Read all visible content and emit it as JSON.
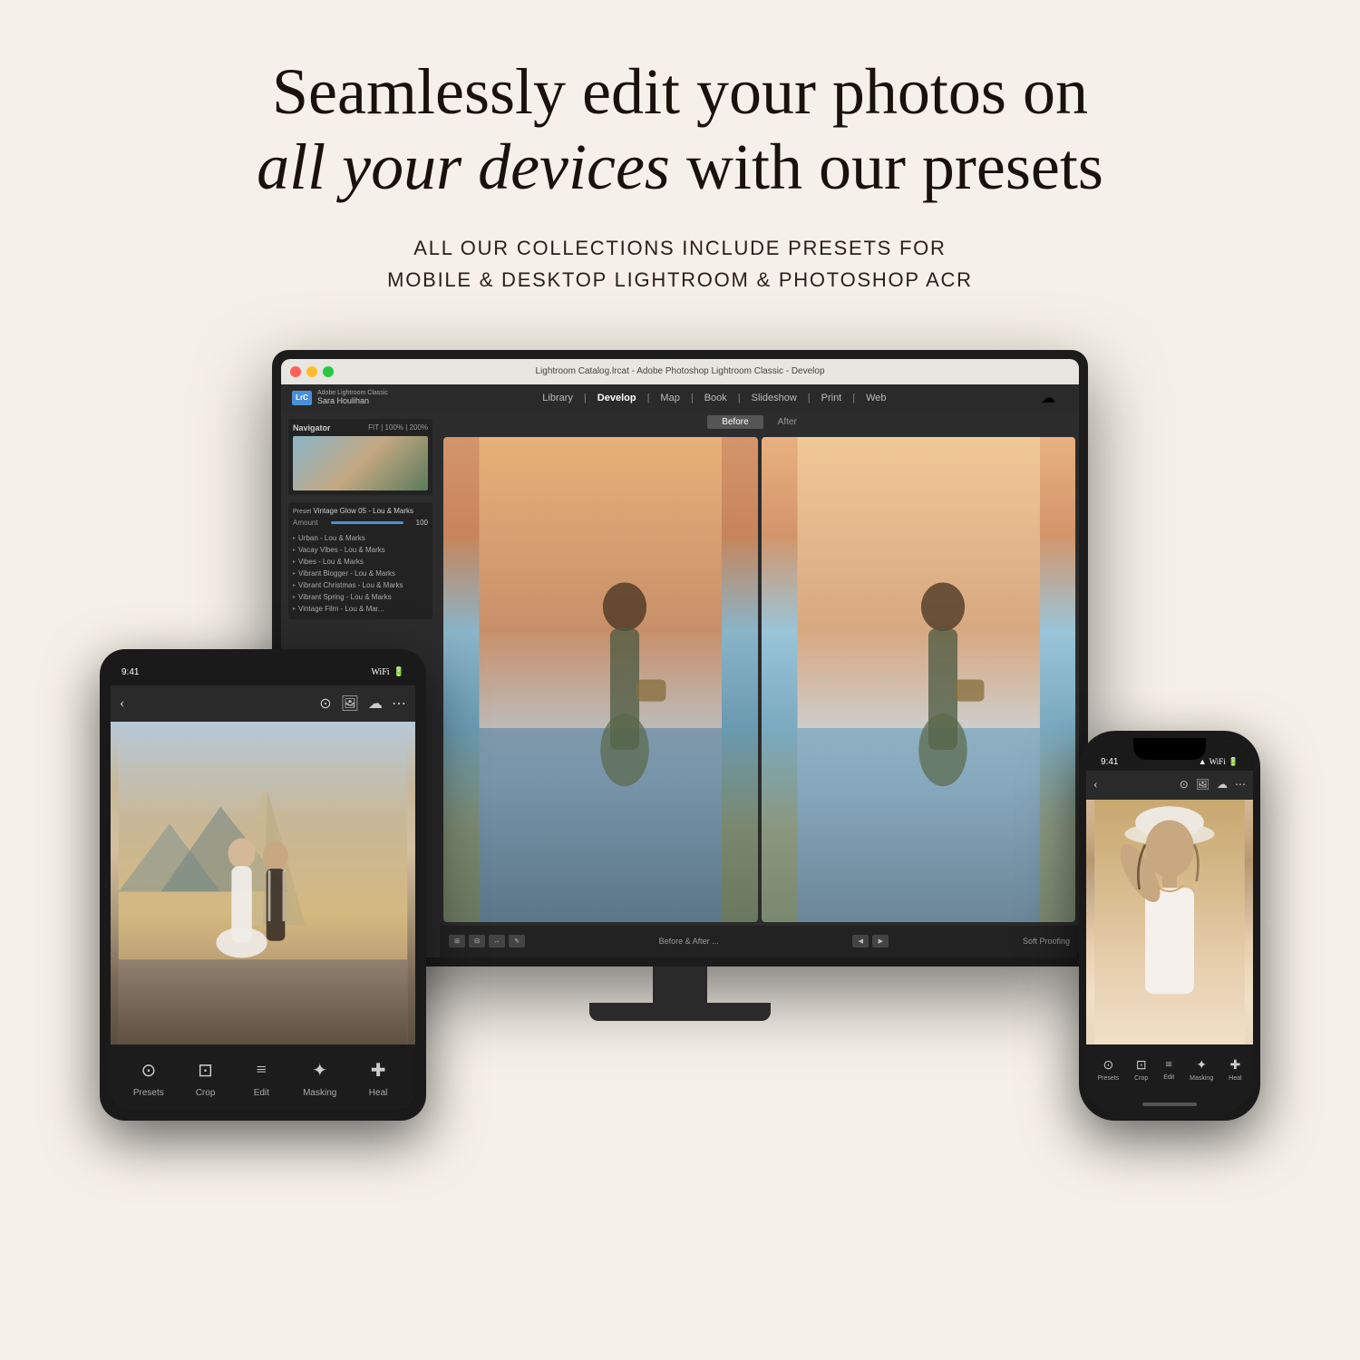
{
  "page": {
    "bg_color": "#f5f0e8"
  },
  "headline": {
    "line1": "Seamlessly edit your photos on",
    "line2_italic": "all your devices",
    "line2_normal": " with our presets"
  },
  "subheadline": {
    "line1": "ALL OUR COLLECTIONS INCLUDE PRESETS FOR",
    "line2": "MOBILE & DESKTOP LIGHTROOM & PHOTOSHOP ACR"
  },
  "monitor": {
    "title": "Lightroom Catalog.lrcat - Adobe Photoshop Lightroom Classic - Develop",
    "app_name": "Adobe Lightroom Classic",
    "user_name": "Sara Houlihan",
    "logo_text": "LrC",
    "nav": [
      "Library",
      "Develop",
      "Map",
      "Book",
      "Slideshow",
      "Print",
      "Web"
    ],
    "active_nav": "Develop",
    "navigator_label": "Navigator",
    "preset_name": "Vintage Glow 05 - Lou & Marks",
    "amount_label": "Amount",
    "amount_value": "100",
    "presets": [
      "Urban - Lou & Marks",
      "Vacay Vibes - Lou & Marks",
      "Vibes - Lou & Marks",
      "Vibrant Blogger - Lou & Marks",
      "Vibrant Christmas - Lou & Marks",
      "Vibrant Spring - Lou & Marks",
      "Vintage Film - Lou & Mar..."
    ],
    "before_label": "Before",
    "after_label": "After",
    "filmstrip_label": "Before & After ...",
    "soft_proofing": "Soft Proofing"
  },
  "tablet": {
    "time": "9:41",
    "toolbar_items": [
      {
        "label": "Presets",
        "icon": "⊙"
      },
      {
        "label": "Crop",
        "icon": "⊡"
      },
      {
        "label": "Edit",
        "icon": "≡"
      },
      {
        "label": "Masking",
        "icon": "✦"
      },
      {
        "label": "Heal",
        "icon": "✚"
      }
    ]
  },
  "phone": {
    "time": "9:41",
    "toolbar_items": [
      {
        "label": "Presets",
        "icon": "⊙"
      },
      {
        "label": "Crop",
        "icon": "⊡"
      },
      {
        "label": "Edit",
        "icon": "≡"
      },
      {
        "label": "Masking",
        "icon": "✦"
      },
      {
        "label": "Heal",
        "icon": "✚"
      }
    ]
  }
}
